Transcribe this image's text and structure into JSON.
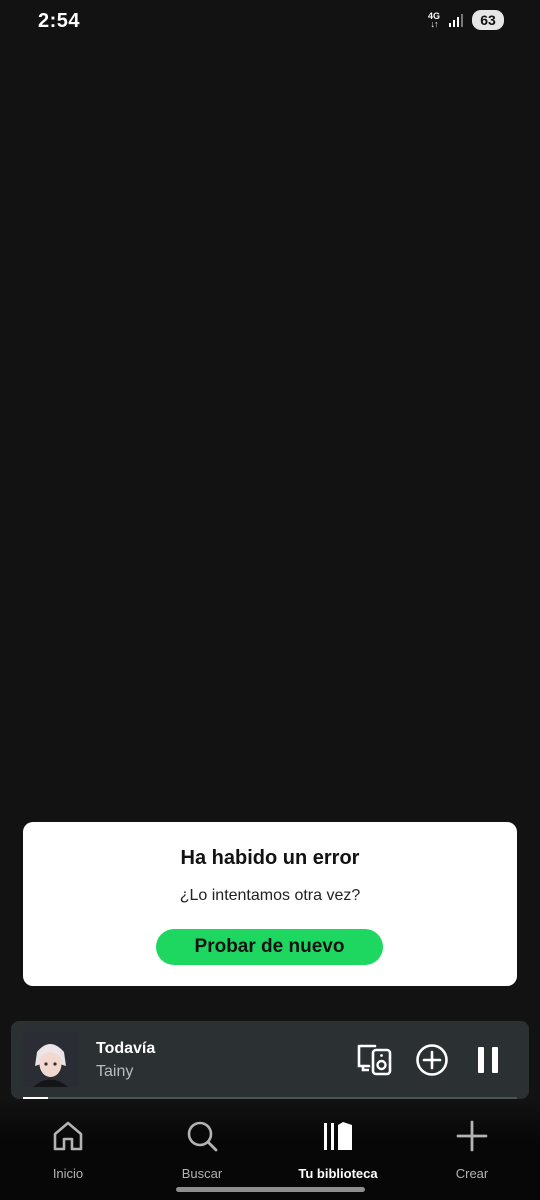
{
  "status_bar": {
    "time": "2:54",
    "network": "4G",
    "battery": "63"
  },
  "error_dialog": {
    "title": "Ha habido un error",
    "message": "¿Lo intentamos otra vez?",
    "retry_label": "Probar de nuevo"
  },
  "mini_player": {
    "track_title": "Todavía",
    "artist": "Tainy",
    "progress": 0.05,
    "is_playing": true
  },
  "bottom_nav": {
    "items": [
      {
        "label": "Inicio",
        "icon": "home-icon",
        "active": false
      },
      {
        "label": "Buscar",
        "icon": "search-icon",
        "active": false
      },
      {
        "label": "Tu biblioteca",
        "icon": "library-icon",
        "active": true
      },
      {
        "label": "Crear",
        "icon": "plus-icon",
        "active": false
      }
    ]
  },
  "colors": {
    "background": "#121212",
    "accent": "#1ed760",
    "player_bg": "#2b3133"
  }
}
